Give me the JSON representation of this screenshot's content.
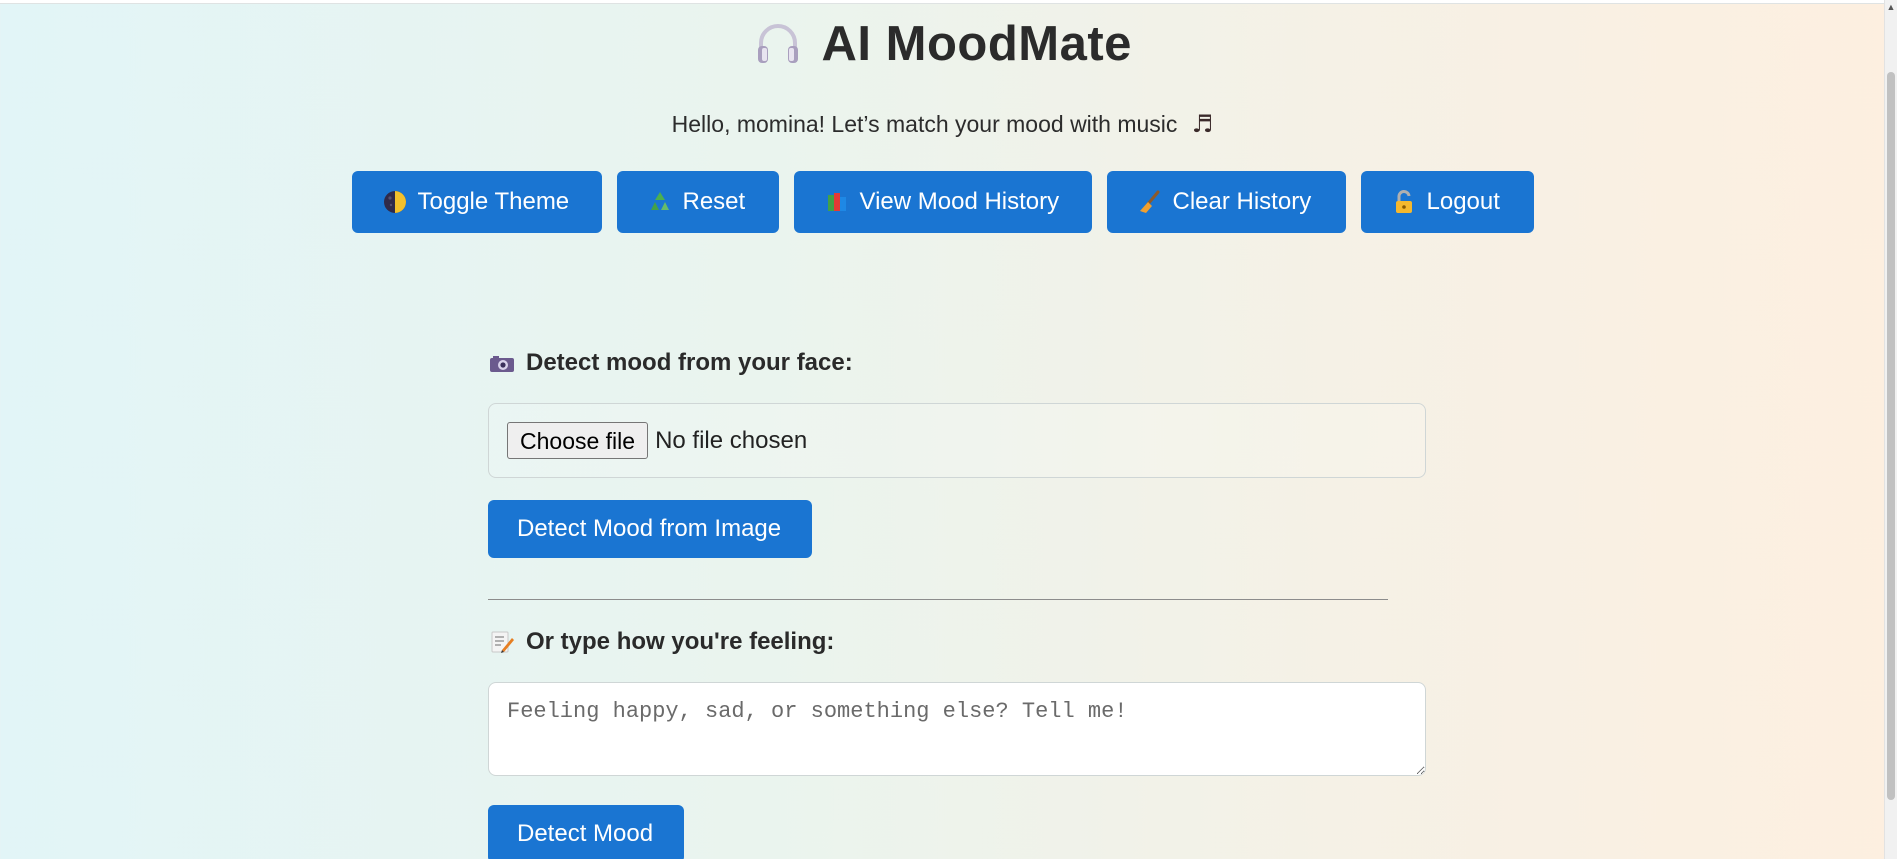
{
  "app": {
    "title": "AI MoodMate",
    "greeting": "Hello, momina! Let’s match your mood with music"
  },
  "icons": {
    "title_icon": "headphones-icon",
    "greeting_icon": "music-note-icon",
    "greeting_glyph": "♬"
  },
  "toolbar": {
    "toggle_theme": "Toggle Theme",
    "reset": "Reset",
    "view_history": "View Mood History",
    "clear_history": "Clear History",
    "logout": "Logout"
  },
  "face_section": {
    "label": "Detect mood from your face:",
    "choose_file": "Choose file",
    "file_status": "No file chosen",
    "detect_button": "Detect Mood from Image"
  },
  "text_section": {
    "label": "Or type how you're feeling:",
    "placeholder": "Feeling happy, sad, or something else? Tell me!",
    "detect_button": "Detect Mood"
  },
  "colors": {
    "button_blue": "#1a75d2",
    "title_text": "#2b2b2b",
    "bg_left": "#e2f5f7",
    "bg_right": "#fdefe0"
  }
}
